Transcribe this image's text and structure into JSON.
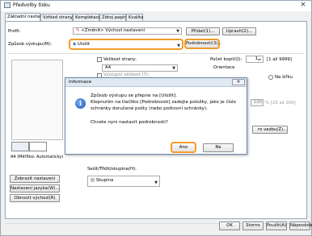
{
  "window": {
    "title": "Předvolby tisku",
    "close_glyph": "×"
  },
  "tabs": [
    "Základní nastavení",
    "Vzhled strany",
    "Kompletace",
    "Zdroj papíru",
    "Kvalita"
  ],
  "profile": {
    "label": "Profil:",
    "value": "<Změnit> Výchozí nastavení",
    "add_label": "Přidat(1)...",
    "edit_label": "Upravit(2)..."
  },
  "output": {
    "label": "Způsob výstupu(M):",
    "value": "Uložit",
    "details_label": "Podrobnosti(3)..."
  },
  "page_size": {
    "label": "Velikost strany:",
    "value": "A4",
    "partial_label": "Výstupní velikost (T):"
  },
  "copies": {
    "label": "Počet kopií(Q):",
    "value": "1",
    "range": "[1 až 9999]"
  },
  "orientation": {
    "label": "Orientace",
    "landscape_label": "Na šířku"
  },
  "scale": {
    "value": "100",
    "range": "% [25 až 200]"
  },
  "preview": {
    "caption": "A4 (Měřítko: Automaticky)"
  },
  "left_buttons": [
    "Zobrazit nastavení",
    "Nastavení jazyka(W)...",
    "Obnovit výchozí(R)"
  ],
  "finishing": {
    "label": "Sešít/Třídit/skupina(H):",
    "value": "Skupina"
  },
  "right_button_partial": "ro vazbu(Z)...",
  "footer": [
    "OK",
    "Storno",
    "Použít(A)",
    "Nápověda"
  ],
  "dialog": {
    "title": "Informace",
    "close_glyph": "×",
    "lines": [
      "Způsob výstupu se přepne na [Uložit].",
      "Klepnutím na tlačítko [Podrobnosti] zadejte položky, jako je číslo",
      "schránky doručené pošty (nebo poštovní schránky)."
    ],
    "question": "Chcete nyní nastavit podrobnosti?",
    "yes_label": "Ano",
    "no_label": "Ne"
  },
  "colors": {
    "highlight": "#f29b2a",
    "info_blue": "#1f5cc0"
  }
}
